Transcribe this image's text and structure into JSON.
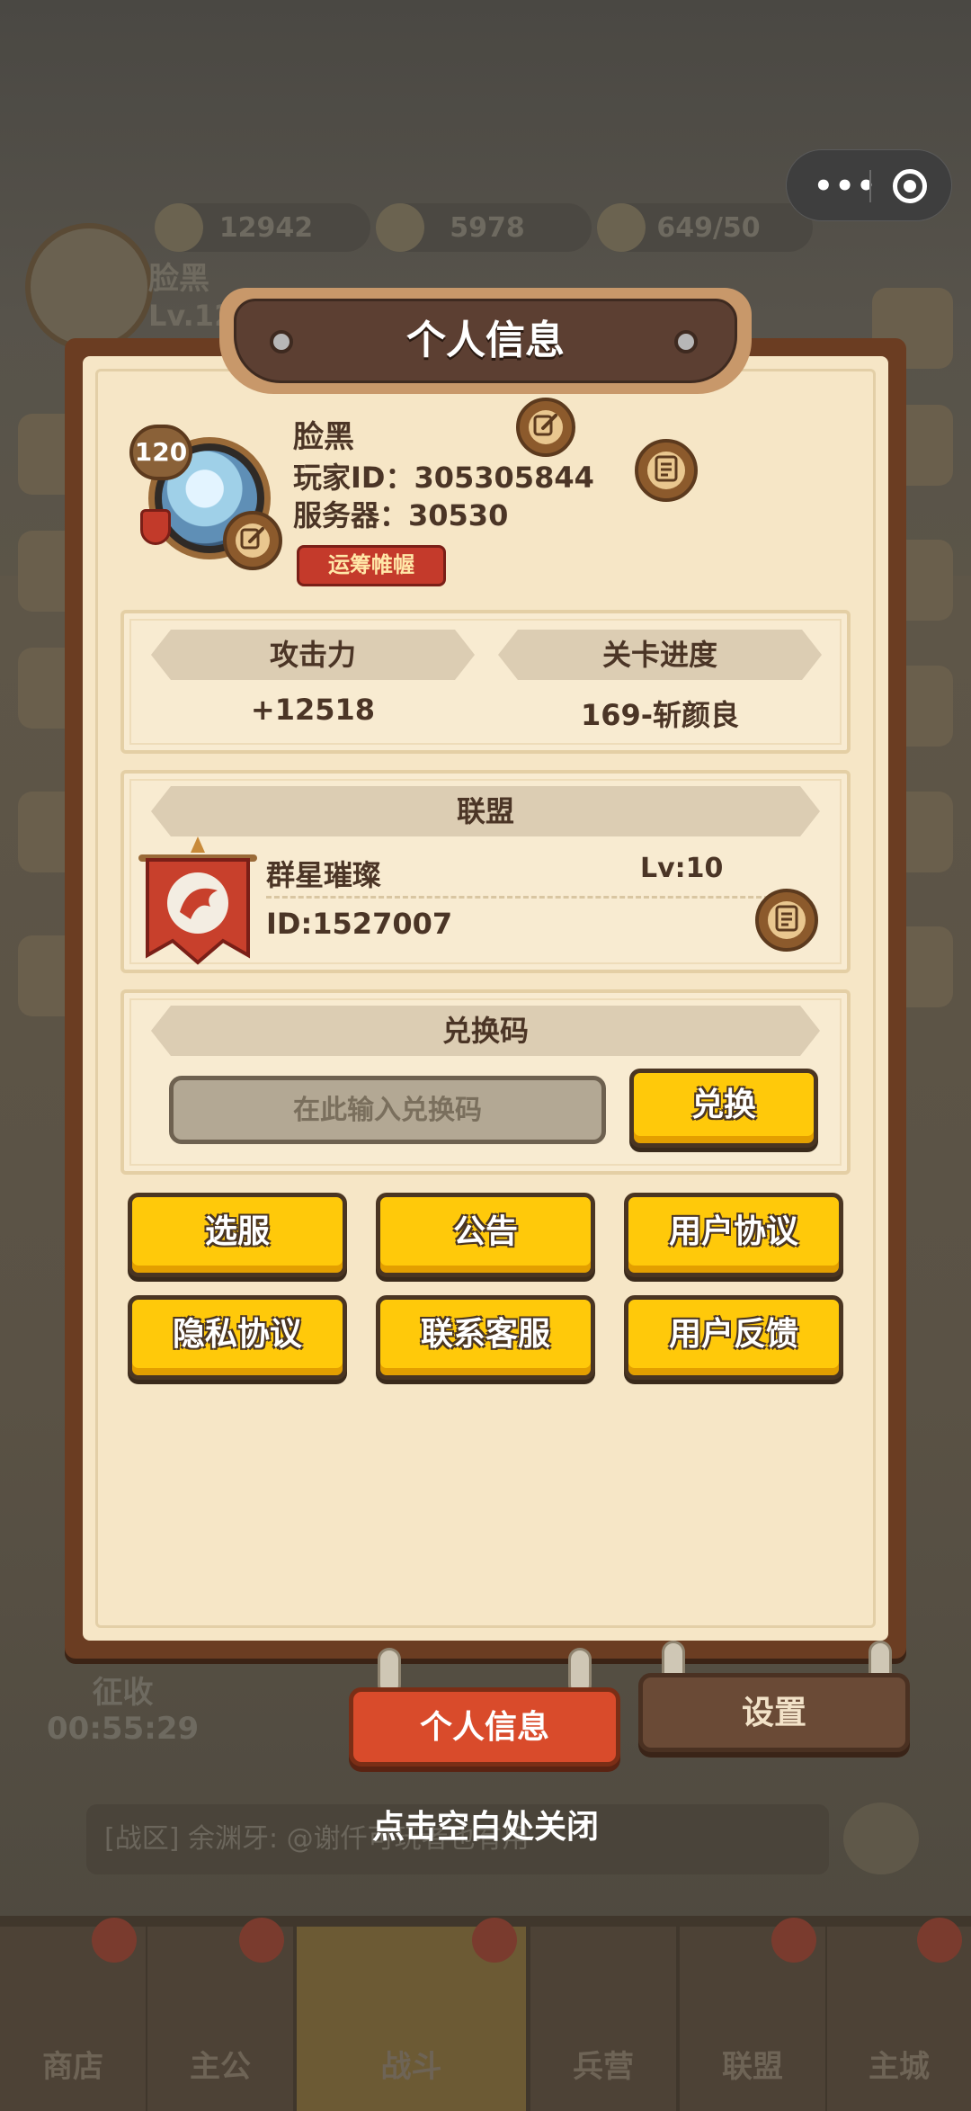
{
  "background": {
    "resources": [
      "12942",
      "5978",
      "649/50"
    ],
    "player_name": "脸黑",
    "player_level": "Lv.120",
    "collect": {
      "label": "征收",
      "timer": "00:55:29"
    },
    "chat": "[战区] 余渊牙: @谢仟可玩者也有用",
    "tabs": [
      "商店",
      "主公",
      "战斗",
      "兵营",
      "联盟",
      "主城"
    ]
  },
  "capsule": {
    "more": "•••"
  },
  "dialog": {
    "title": "个人信息",
    "profile": {
      "level_badge": "120",
      "name": "脸黑",
      "player_id": "玩家ID：305305844",
      "server": "服务器：30530",
      "title_badge": "运筹帷幄"
    },
    "stats": {
      "attack_label": "攻击力",
      "attack_value": "+12518",
      "progress_label": "关卡进度",
      "progress_value": "169-斩颜良"
    },
    "alliance": {
      "header": "联盟",
      "name": "群星璀璨",
      "level": "Lv:10",
      "id": "ID:1527007"
    },
    "redeem": {
      "header": "兑换码",
      "placeholder": "在此输入兑换码",
      "button": "兑换"
    },
    "buttons": [
      "选服",
      "公告",
      "用户协议",
      "隐私协议",
      "联系客服",
      "用户反馈"
    ],
    "tabs": {
      "active": "个人信息",
      "inactive": "设置"
    },
    "close_tip": "点击空白处关闭"
  }
}
